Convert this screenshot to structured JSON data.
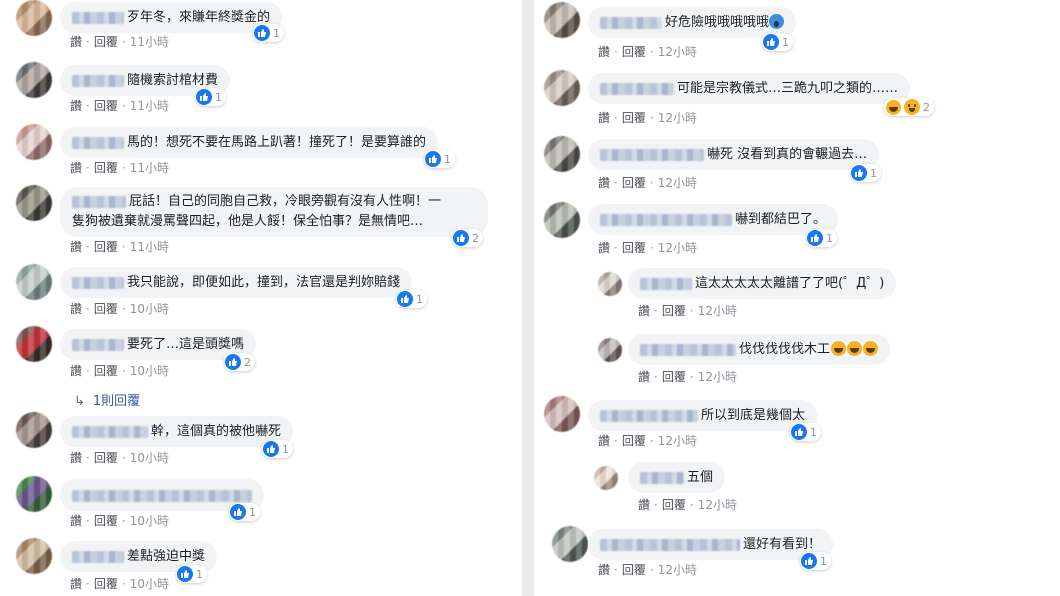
{
  "actions": {
    "like": "讚",
    "reply": "回覆",
    "separator": "·"
  },
  "left_comments": [
    {
      "text": "歹年冬，來賺年終獎金的",
      "time": "11小時",
      "likes": "1"
    },
    {
      "text": "隨機索討棺材費",
      "time": "11小時",
      "likes": "1"
    },
    {
      "text": "馬的！想死不要在馬路上趴著！撞死了！是要算誰的",
      "time": "11小時",
      "likes": "1"
    },
    {
      "text_line1": "屁話！自己的同胞自己救，冷眼旁觀有沒有人性啊！一",
      "text_line2": "隻狗被遺棄就漫罵聲四起，他是人餒！保全怕事？是無情吧…",
      "time": "11小時",
      "likes": "2"
    },
    {
      "text": "我只能說，即便如此，撞到，法官還是判妳賠錢",
      "time": "10小時",
      "likes": "1"
    },
    {
      "text": "要死了…這是頭獎嗎",
      "time": "10小時",
      "likes": "2"
    },
    {
      "text": "幹，這個真的被他嚇死",
      "time": "10小時",
      "likes": "1"
    },
    {
      "text": "",
      "time": "10小時",
      "likes": "1"
    },
    {
      "text": "差點強迫中獎",
      "time": "10小時",
      "likes": "1"
    }
  ],
  "left_replies_link": "1則回覆",
  "right_comments": [
    {
      "text": "好危險哦哦哦哦哦",
      "time": "12小時",
      "likes": "1"
    },
    {
      "text": "可能是宗教儀式…三跪九叩之類的……",
      "time": "12小時",
      "likes": "2"
    },
    {
      "text": "嚇死 沒看到真的會輾過去…",
      "time": "12小時",
      "likes": "1"
    },
    {
      "text": "嚇到都結巴了。",
      "time": "12小時",
      "likes": "1"
    },
    {
      "text": "這太太太太太離譜了了吧(゜Д゜)",
      "time": "12小時",
      "likes": ""
    },
    {
      "text": "伐伐伐伐伐木工",
      "time": "12小時",
      "likes": ""
    },
    {
      "text": "所以到底是幾個太",
      "time": "12小時",
      "likes": "1"
    },
    {
      "text": "五個",
      "time": "12小時",
      "likes": ""
    },
    {
      "text": "還好有看到！",
      "time": "12小時",
      "likes": "1"
    }
  ],
  "colors": {
    "like_blue": "#1877f2",
    "link_blue": "#385898",
    "bubble_bg": "#f2f3f5",
    "page_bg": "#e9ebee"
  },
  "icons": {
    "like": "thumbs-up-icon",
    "reply_arrow": "reply-arrow-icon",
    "haha": "haha-emoji-icon",
    "wow": "wow-emoji-icon"
  }
}
